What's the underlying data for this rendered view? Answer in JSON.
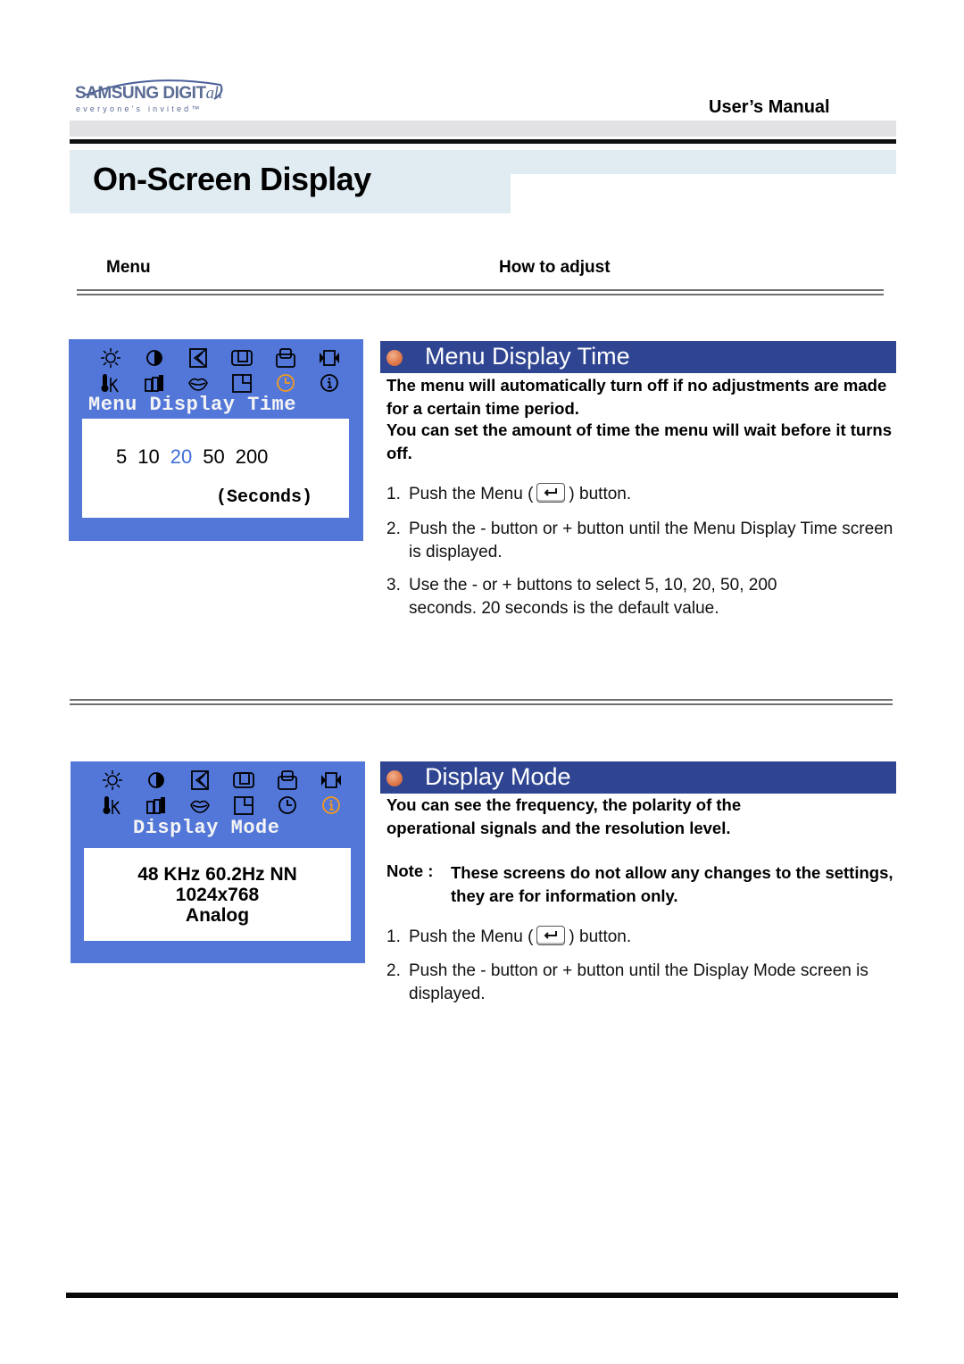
{
  "header": {
    "brand": "SAMSUNG DIGIT",
    "brand_suffix": "all",
    "tagline": "everyone's invited™",
    "manual_label": "User’s Manual",
    "page_title": "On-Screen Display"
  },
  "columns": {
    "menu": "Menu",
    "how_to_adjust": "How to adjust"
  },
  "osd_icons": {
    "row1": [
      "brightness-icon",
      "contrast-icon",
      "position-icon",
      "size-icon",
      "image-lock-icon",
      "zoom-icon"
    ],
    "row2": [
      "color-temperature-icon",
      "color-control-icon",
      "recall-icon",
      "osd-position-icon",
      "clock-icon",
      "info-icon"
    ]
  },
  "sections": [
    {
      "title": "Menu Display Time",
      "osd": {
        "title": "Menu Display Time",
        "selected_icon": "clock-icon",
        "options": [
          "5",
          "10",
          "20",
          "50",
          "200"
        ],
        "selected_option": "20",
        "unit": "(Seconds)"
      },
      "description": [
        "The menu will automatically turn off if no adjustments are made for a certain time period.",
        "You can set the amount of time the menu will wait before it turns off."
      ],
      "steps": [
        {
          "num": "1.",
          "before": "Push the Menu (",
          "after": ") button."
        },
        {
          "num": "2.",
          "text": "Push the - button or + button until the Menu Display Time screen is displayed."
        },
        {
          "num": "3.",
          "text": "Use the - or + buttons to select 5, 10, 20, 50, 200 seconds. 20 seconds is the default value."
        }
      ]
    },
    {
      "title": "Display Mode",
      "osd": {
        "title": "Display Mode",
        "selected_icon": "info-icon",
        "lines": [
          "48 KHz 60.2Hz NN",
          "1024x768",
          "Analog"
        ]
      },
      "description": [
        "You can see the frequency, the polarity of the operational signals and the resolution level."
      ],
      "note_label": "Note :",
      "note_text": "These screens do not allow any changes to the settings, they are for information only.",
      "steps": [
        {
          "num": "1.",
          "before": "Push the Menu (",
          "after": ") button."
        },
        {
          "num": "2.",
          "text": "Push the - button or + button until the Display Mode screen is displayed."
        }
      ]
    }
  ],
  "colors": {
    "osd_blue": "#5277d8",
    "section_header": "#2f4592",
    "selected_option": "#3d6ed8",
    "selected_icon": "#f39a1e",
    "title_band": "#e0ebf2"
  }
}
